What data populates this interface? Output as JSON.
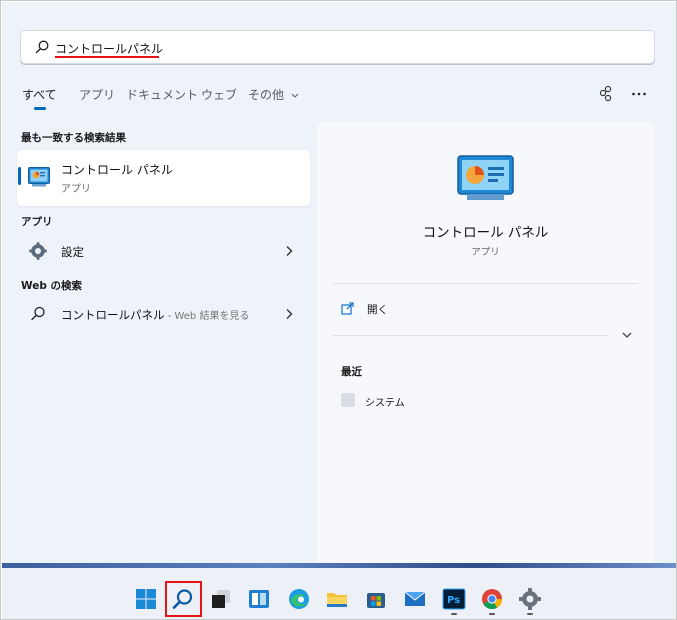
{
  "search": {
    "value": "コントロールパネル"
  },
  "tabs": [
    {
      "label": "すべて"
    },
    {
      "label": "アプリ"
    },
    {
      "label": "ドキュメント"
    },
    {
      "label": "ウェブ"
    },
    {
      "label": "その他"
    }
  ],
  "sections": {
    "best_match": "最も一致する検索結果",
    "apps": "アプリ",
    "web": "Web の検索"
  },
  "best_match": {
    "title": "コントロール パネル",
    "subtitle": "アプリ"
  },
  "apps": [
    {
      "label": "設定",
      "icon": "gear-icon"
    }
  ],
  "web": [
    {
      "label": "コントロールパネル",
      "suffix": " - Web 結果を見る",
      "icon": "search-icon"
    }
  ],
  "detail": {
    "title": "コントロール パネル",
    "subtitle": "アプリ",
    "open_label": "開く",
    "recent_head": "最近",
    "recent": [
      {
        "label": "システム"
      }
    ]
  },
  "taskbar": {
    "icons": [
      "windows-start-icon",
      "search-icon",
      "task-view-icon",
      "widgets-icon",
      "edge-icon",
      "file-explorer-icon",
      "store-icon",
      "mail-icon",
      "photoshop-icon",
      "chrome-icon",
      "settings-icon"
    ]
  },
  "colors": {
    "accent": "#0067c0",
    "highlight": "#e31515"
  }
}
